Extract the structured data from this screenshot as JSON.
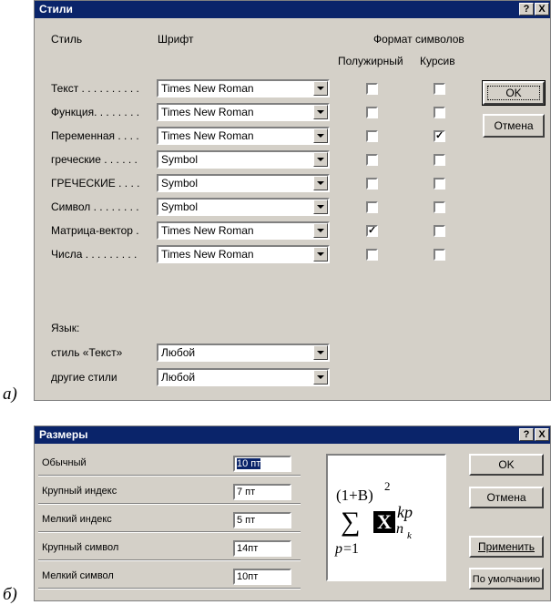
{
  "captions": {
    "a": "а)",
    "b": "б)"
  },
  "styles_dialog": {
    "title": "Стили",
    "help_button": "?",
    "close_button": "X",
    "headers": {
      "style": "Стиль",
      "font": "Шрифт",
      "char_format": "Формат символов",
      "bold": "Полужирный",
      "italic": "Курсив"
    },
    "rows": [
      {
        "label": "Текст . . . . . . . . . .",
        "font": "Times New Roman",
        "bold": false,
        "italic": false
      },
      {
        "label": "Функция. . . . . . . .",
        "font": "Times New Roman",
        "bold": false,
        "italic": false
      },
      {
        "label": "Переменная . . . .",
        "font": "Times New Roman",
        "bold": false,
        "italic": true
      },
      {
        "label": "греческие . . . . . .",
        "font": "Symbol",
        "bold": false,
        "italic": false
      },
      {
        "label": "ГРЕЧЕСКИЕ . . . .",
        "font": "Symbol",
        "bold": false,
        "italic": false
      },
      {
        "label": "Символ . . . . . . . .",
        "font": "Symbol",
        "bold": false,
        "italic": false
      },
      {
        "label": "Матрица-вектор .",
        "font": "Times New Roman",
        "bold": true,
        "italic": false
      },
      {
        "label": "Числа . . . . . . . . .",
        "font": "Times New Roman",
        "bold": false,
        "italic": false
      }
    ],
    "language_label": "Язык:",
    "lang_rows": [
      {
        "label": "стиль «Текст»",
        "value": "Любой"
      },
      {
        "label": "другие стили",
        "value": "Любой"
      }
    ],
    "ok": "OK",
    "cancel": "Отмена",
    "check_mark": "✓"
  },
  "sizes_dialog": {
    "title": "Размеры",
    "help_button": "?",
    "close_button": "X",
    "rows": [
      {
        "label": "Обычный",
        "value": "10 пт"
      },
      {
        "label": "Крупный индекс",
        "value": "7 пт"
      },
      {
        "label": "Мелкий индекс",
        "value": "5 пт"
      },
      {
        "label": "Крупный символ",
        "value": "14пт"
      },
      {
        "label": "Мелкий символ",
        "value": "10пт"
      }
    ],
    "ok": "OK",
    "cancel": "Отмена",
    "apply": "Применить",
    "default": "По умолчанию",
    "preview": {
      "base": "(1+B)",
      "exp": "2",
      "sigma": "∑",
      "sub_p": "p",
      "sub_rest": "=1",
      "boxed": "X",
      "sup_kp": "kp",
      "sub_n": "n",
      "sub_k": "k"
    }
  }
}
